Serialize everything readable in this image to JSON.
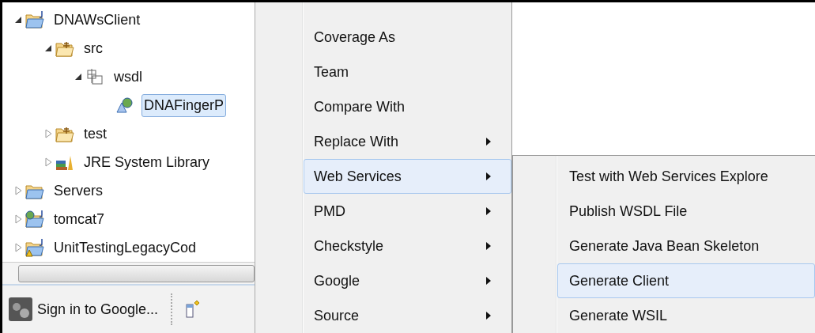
{
  "tree": [
    {
      "label": "DNAWsClient",
      "kind": "project",
      "expanded": true,
      "selected": false,
      "children": [
        {
          "label": "src",
          "kind": "package-folder",
          "expanded": true,
          "selected": false,
          "children": [
            {
              "label": "wsdl",
              "kind": "package",
              "expanded": true,
              "selected": false,
              "children": [
                {
                  "label": "DNAFingerP",
                  "kind": "wsdl-file",
                  "selected": true
                }
              ]
            }
          ]
        },
        {
          "label": "test",
          "kind": "package-folder",
          "expanded": false,
          "selected": false
        },
        {
          "label": "JRE System Library",
          "kind": "library",
          "expanded": false,
          "selected": false
        }
      ]
    },
    {
      "label": "Servers",
      "kind": "folder",
      "expanded": false,
      "selected": false
    },
    {
      "label": "tomcat7",
      "kind": "web-project",
      "expanded": false,
      "selected": false
    },
    {
      "label": "UnitTestingLegacyCod",
      "kind": "warning-project",
      "expanded": false,
      "selected": false
    }
  ],
  "status_bar": {
    "sign_in": "Sign in to Google..."
  },
  "context_menu": [
    {
      "label": "Coverage As",
      "submenu": false,
      "selected": false
    },
    {
      "label": "Team",
      "submenu": false,
      "selected": false
    },
    {
      "label": "Compare With",
      "submenu": false,
      "selected": false
    },
    {
      "label": "Replace With",
      "submenu": true,
      "selected": false
    },
    {
      "label": "Web Services",
      "submenu": true,
      "selected": true
    },
    {
      "label": "PMD",
      "submenu": true,
      "selected": false
    },
    {
      "label": "Checkstyle",
      "submenu": true,
      "selected": false
    },
    {
      "label": "Google",
      "submenu": true,
      "selected": false
    },
    {
      "label": "Source",
      "submenu": true,
      "selected": false
    }
  ],
  "submenu": [
    {
      "label": "Test with Web Services Explore",
      "selected": false
    },
    {
      "label": "Publish WSDL File",
      "selected": false
    },
    {
      "label": "Generate Java Bean Skeleton",
      "selected": false
    },
    {
      "label": "Generate Client",
      "selected": true
    },
    {
      "label": "Generate WSIL",
      "selected": false
    }
  ]
}
